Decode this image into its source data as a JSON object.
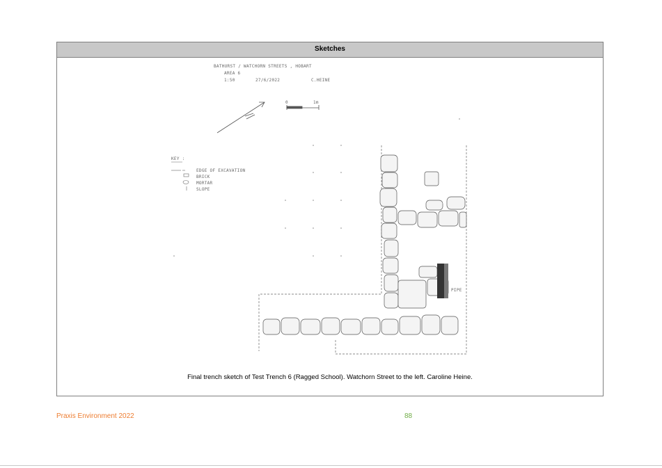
{
  "section": {
    "header": "Sketches",
    "caption": "Final trench sketch of Test Trench 6 (Ragged School).  Watchorn Street to the left.  Caroline Heine."
  },
  "sketch_notes": {
    "title_line1": "BATHURST / WATCHORN STREETS , HOBART",
    "title_line2": "AREA 6",
    "scale": "1:50",
    "date": "27/6/2022",
    "author": "C.HEINE",
    "scale_bar_start": "0",
    "scale_bar_end": "1m",
    "key_heading": "KEY :",
    "key_items": [
      "EDGE OF EXCAVATION",
      "BRICK",
      "MORTAR",
      "SLOPE"
    ],
    "pipe_label": "PIPE"
  },
  "footer": {
    "left": "Praxis Environment 2022",
    "page_number": "88"
  }
}
